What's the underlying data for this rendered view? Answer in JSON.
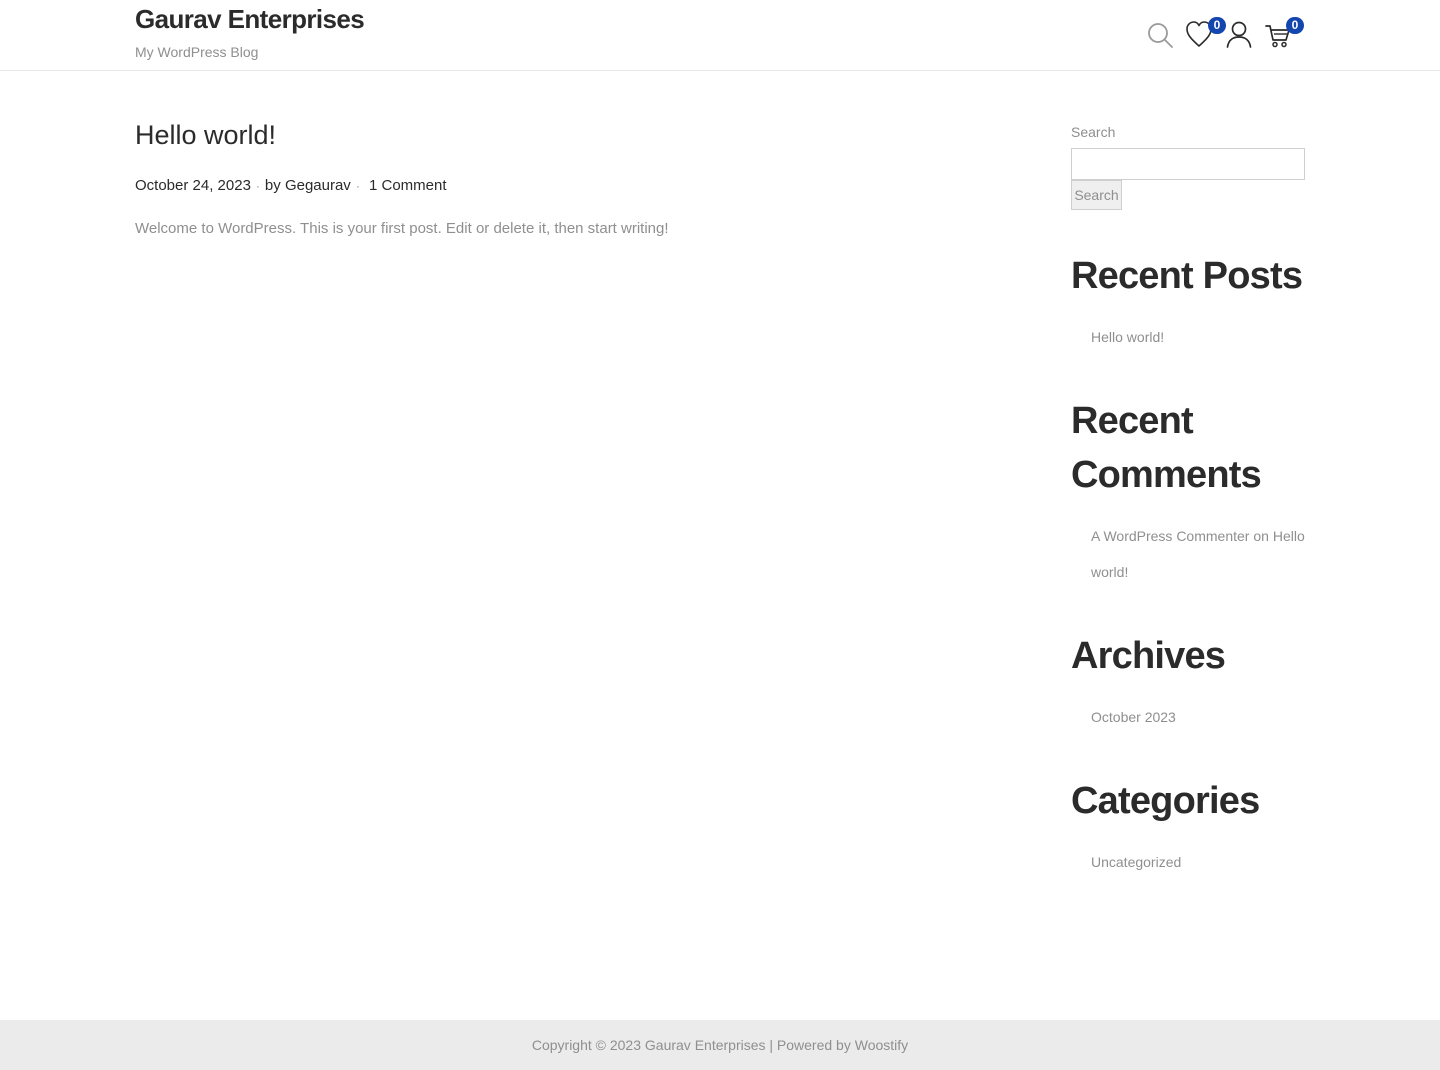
{
  "header": {
    "site_title": "Gaurav Enterprises",
    "tagline": "My WordPress Blog",
    "wishlist_count": "0",
    "cart_count": "0",
    "icons": [
      "search-icon",
      "heart-icon",
      "user-icon",
      "cart-icon"
    ],
    "badge_color": "#1346af"
  },
  "post": {
    "title": "Hello world!",
    "date": "October 24, 2023",
    "author_prefix": "by",
    "author": "Gegaurav",
    "meta_separator": "·",
    "comments": "1 Comment",
    "excerpt": "Welcome to WordPress. This is your first post. Edit or delete it, then start writing!"
  },
  "sidebar": {
    "search": {
      "label": "Search",
      "value": "",
      "button_label": "Search"
    },
    "recent_posts": {
      "title": "Recent Posts",
      "items": [
        "Hello world!"
      ]
    },
    "recent_comments": {
      "title": "Recent Comments",
      "author": "A WordPress Commenter",
      "connector": "on",
      "post": "Hello world!"
    },
    "archives": {
      "title": "Archives",
      "items": [
        "October 2023"
      ]
    },
    "categories": {
      "title": "Categories",
      "items": [
        "Uncategorized"
      ]
    }
  },
  "footer": {
    "text": "Copyright © 2023 Gaurav Enterprises | Powered by Woostify"
  }
}
